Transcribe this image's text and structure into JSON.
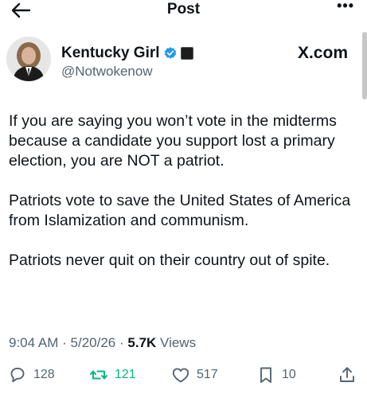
{
  "header": {
    "title": "Post",
    "back_icon": "arrow-left-icon",
    "more_icon": "more-dots-icon",
    "more_label": "•••"
  },
  "author": {
    "display_name": "Kentucky Girl",
    "handle": "@Notwokenow",
    "verified_color": "#1d9bf0",
    "avatar_icon": "profile-avatar"
  },
  "watermark": "X.com",
  "tweet": {
    "paragraphs": [
      "If you are saying you won’t vote in the midterms because a candidate you support lost a primary election, you are NOT a patriot.",
      "Patriots vote to save the United States of America from Islamization and communism.",
      "Patriots never quit on their country out of spite."
    ]
  },
  "meta": {
    "time": "9:04 AM",
    "separator": "·",
    "date": "5/20/26",
    "views_count": "5.7K",
    "views_label": "Views"
  },
  "actions": {
    "replies": "128",
    "reposts": "121",
    "likes": "517",
    "bookmarks": "10",
    "repost_color": "#00ba7c",
    "muted_color": "#536471"
  }
}
